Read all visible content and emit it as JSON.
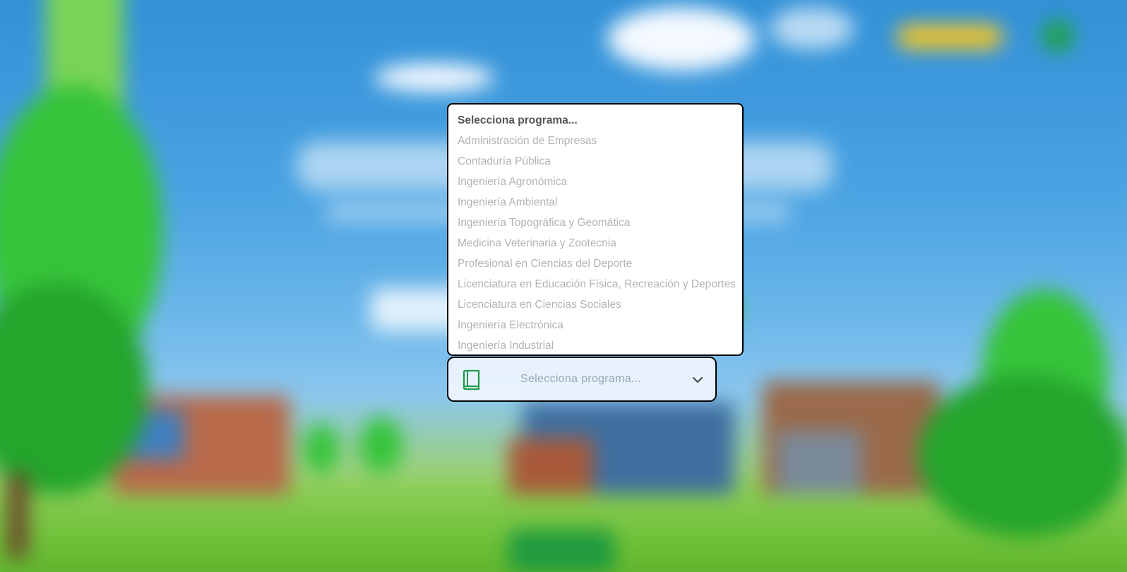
{
  "program_select": {
    "placeholder": "Selecciona programa...",
    "icon": "book-icon",
    "chevron_icon": "chevron-down-icon",
    "options": [
      "Selecciona programa...",
      "Administración de Empresas",
      "Contaduría Pública",
      "Ingeniería Agronómica",
      "Ingeniería Ambiental",
      "Ingeniería Topográfica y Geomática",
      "Medicina Veterinaria y Zootecnia",
      "Profesional en Ciencias del Deporte",
      "Licenciatura en Educación Física, Recreación y Deportes",
      "Licenciatura en Ciencias Sociales",
      "Ingeniería Electrónica",
      "Ingeniería Industrial"
    ]
  },
  "colors": {
    "accent": "#1f9a4a",
    "option_text": "#b3b3b3",
    "placeholder_text": "#555555"
  }
}
